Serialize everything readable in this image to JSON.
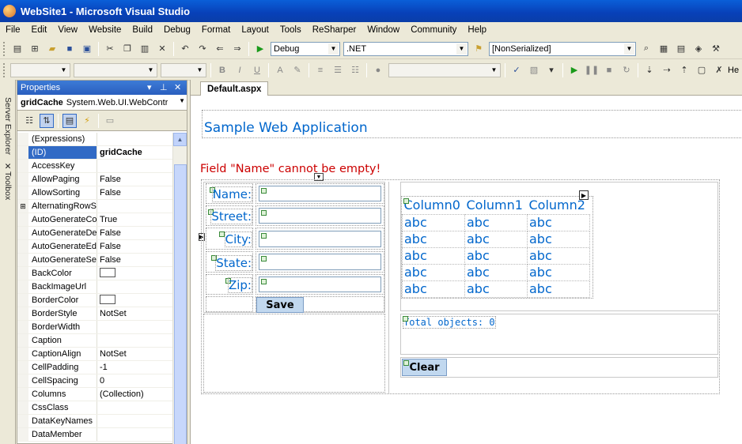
{
  "window": {
    "title": "WebSite1 - Microsoft Visual Studio"
  },
  "menu": [
    "File",
    "Edit",
    "View",
    "Website",
    "Build",
    "Debug",
    "Format",
    "Layout",
    "Tools",
    "ReSharper",
    "Window",
    "Community",
    "Help"
  ],
  "toolbar1": {
    "config": "Debug",
    "platform": ".NET",
    "target": "[NonSerialized]"
  },
  "toolbar2": {
    "overflow_text": "He"
  },
  "side_tabs": {
    "server_explorer": "Server Explorer",
    "toolbox": "Toolbox"
  },
  "properties": {
    "title": "Properties",
    "object_name": "gridCache",
    "object_type": "System.Web.UI.WebContr",
    "rows": [
      {
        "name": "(Expressions)",
        "value": ""
      },
      {
        "name": "(ID)",
        "value": "gridCache",
        "selected": true
      },
      {
        "name": "AccessKey",
        "value": ""
      },
      {
        "name": "AllowPaging",
        "value": "False"
      },
      {
        "name": "AllowSorting",
        "value": "False"
      },
      {
        "name": "AlternatingRowSt",
        "value": "",
        "expandable": true
      },
      {
        "name": "AutoGenerateCo",
        "value": "True"
      },
      {
        "name": "AutoGenerateDe",
        "value": "False"
      },
      {
        "name": "AutoGenerateEdi",
        "value": "False"
      },
      {
        "name": "AutoGenerateSel",
        "value": "False"
      },
      {
        "name": "BackColor",
        "value": "",
        "swatch": true
      },
      {
        "name": "BackImageUrl",
        "value": ""
      },
      {
        "name": "BorderColor",
        "value": "",
        "swatch": true
      },
      {
        "name": "BorderStyle",
        "value": "NotSet"
      },
      {
        "name": "BorderWidth",
        "value": ""
      },
      {
        "name": "Caption",
        "value": ""
      },
      {
        "name": "CaptionAlign",
        "value": "NotSet"
      },
      {
        "name": "CellPadding",
        "value": "-1"
      },
      {
        "name": "CellSpacing",
        "value": "0"
      },
      {
        "name": "Columns",
        "value": "(Collection)"
      },
      {
        "name": "CssClass",
        "value": ""
      },
      {
        "name": "DataKeyNames",
        "value": ""
      },
      {
        "name": "DataMember",
        "value": ""
      }
    ]
  },
  "document": {
    "tab": "Default.aspx",
    "page_title": "Sample Web Application",
    "error_message": "Field \"Name\" cannot be empty!",
    "form": {
      "name_label": "Name:",
      "street_label": "Street:",
      "city_label": "City:",
      "state_label": "State:",
      "zip_label": "Zip:",
      "save_button": "Save"
    },
    "grid": {
      "columns": [
        "Column0",
        "Column1",
        "Column2"
      ],
      "rows": [
        [
          "abc",
          "abc",
          "abc"
        ],
        [
          "abc",
          "abc",
          "abc"
        ],
        [
          "abc",
          "abc",
          "abc"
        ],
        [
          "abc",
          "abc",
          "abc"
        ],
        [
          "abc",
          "abc",
          "abc"
        ]
      ]
    },
    "total_objects": "Total objects: 0",
    "clear_button": "Clear"
  }
}
